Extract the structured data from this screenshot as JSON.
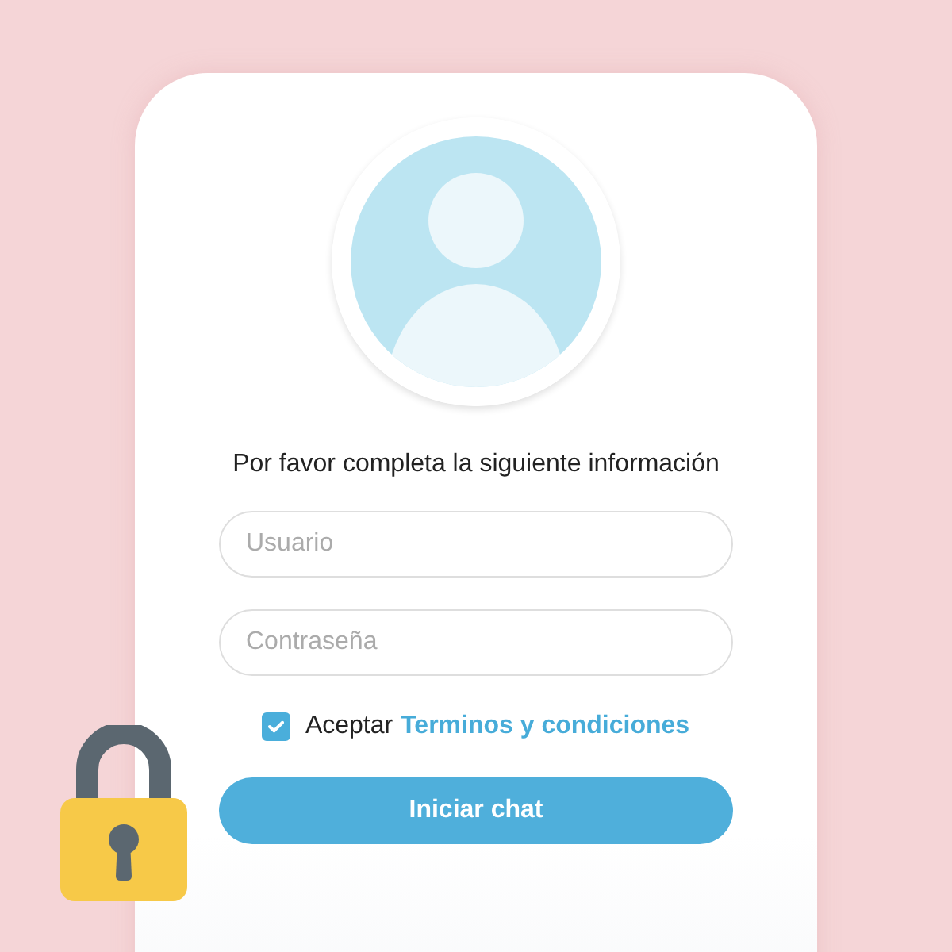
{
  "form": {
    "prompt": "Por favor completa la siguiente información",
    "fields": [
      {
        "placeholder": "Usuario"
      },
      {
        "placeholder": "Contraseña"
      }
    ],
    "terms": {
      "checked": true,
      "label": "Aceptar",
      "link": "Terminos y condiciones"
    },
    "submit": "Iniciar chat"
  }
}
